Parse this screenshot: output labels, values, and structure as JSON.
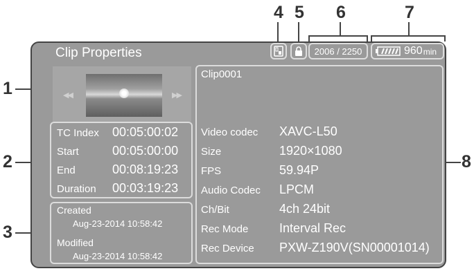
{
  "callouts": [
    "1",
    "2",
    "3",
    "4",
    "5",
    "6",
    "7",
    "8"
  ],
  "screen": {
    "title": "Clip Properties",
    "status": {
      "clip_media_icon": "media-card-icon",
      "lock_icon": "lock-icon",
      "clip_counter": "2006 / 2250",
      "battery_icon": "battery-icon",
      "battery_remaining": "960",
      "battery_unit": "min"
    },
    "thumbnail": {
      "prev_icon": "previous-clip-icon",
      "next_icon": "next-clip-icon"
    },
    "timecodes": [
      {
        "label": "TC Index",
        "value": "00:05:00:02"
      },
      {
        "label": "Start",
        "value": "00:05:00:00"
      },
      {
        "label": "End",
        "value": "00:08:19:23"
      },
      {
        "label": "Duration",
        "value": "00:03:19:23"
      }
    ],
    "dates": {
      "created_label": "Created",
      "created_value": "Aug-23-2014 10:58:42",
      "modified_label": "Modified",
      "modified_value": "Aug-23-2014 10:58:42"
    },
    "clip_name": "Clip0001",
    "properties": [
      {
        "label": "Video codec",
        "value": "XAVC-L50"
      },
      {
        "label": "Size",
        "value": "1920×1080"
      },
      {
        "label": "FPS",
        "value": "59.94P"
      },
      {
        "label": "Audio Codec",
        "value": "LPCM"
      },
      {
        "label": "Ch/Bit",
        "value": "4ch 24bit"
      },
      {
        "label": "Rec Mode",
        "value": "Interval Rec"
      },
      {
        "label": "Rec Device",
        "value": "PXW-Z190V(SN00001014)"
      }
    ]
  }
}
